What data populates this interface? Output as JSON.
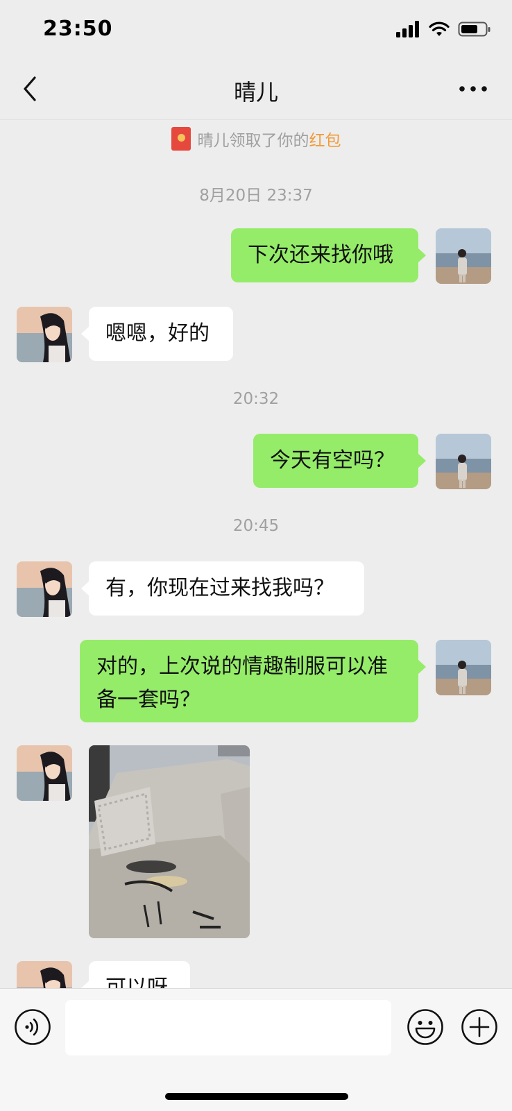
{
  "status_bar": {
    "time": "23:50",
    "icons": [
      "signal-icon",
      "wifi-icon",
      "battery-icon"
    ]
  },
  "nav": {
    "title": "晴儿",
    "back_icon": "chevron-left-icon",
    "more_icon": "more-dots-icon"
  },
  "system": {
    "red_packet_text": "晴儿领取了你的",
    "red_packet_link": "红包",
    "time_1": "8月20日 23:37",
    "time_2": "20:32",
    "time_3": "20:45"
  },
  "messages": [
    {
      "from": "me",
      "text": "下次还来找你哦"
    },
    {
      "from": "her",
      "text": "嗯嗯，好的"
    },
    {
      "from": "me",
      "text": "今天有空吗？"
    },
    {
      "from": "her",
      "text": "有，你现在过来找我吗？"
    },
    {
      "from": "me",
      "text": "对的，上次说的情趣制服可以准备一套吗？"
    },
    {
      "from": "her",
      "type": "image"
    },
    {
      "from": "her",
      "text": "可以呀"
    }
  ],
  "input_bar": {
    "value": "",
    "placeholder": "",
    "voice_icon": "voice-icon",
    "emoji_icon": "emoji-icon",
    "plus_icon": "plus-icon"
  },
  "colors": {
    "my_bubble": "#95ec69",
    "her_bubble": "#ffffff",
    "background": "#ededed",
    "red_packet_link": "#f19a38"
  }
}
